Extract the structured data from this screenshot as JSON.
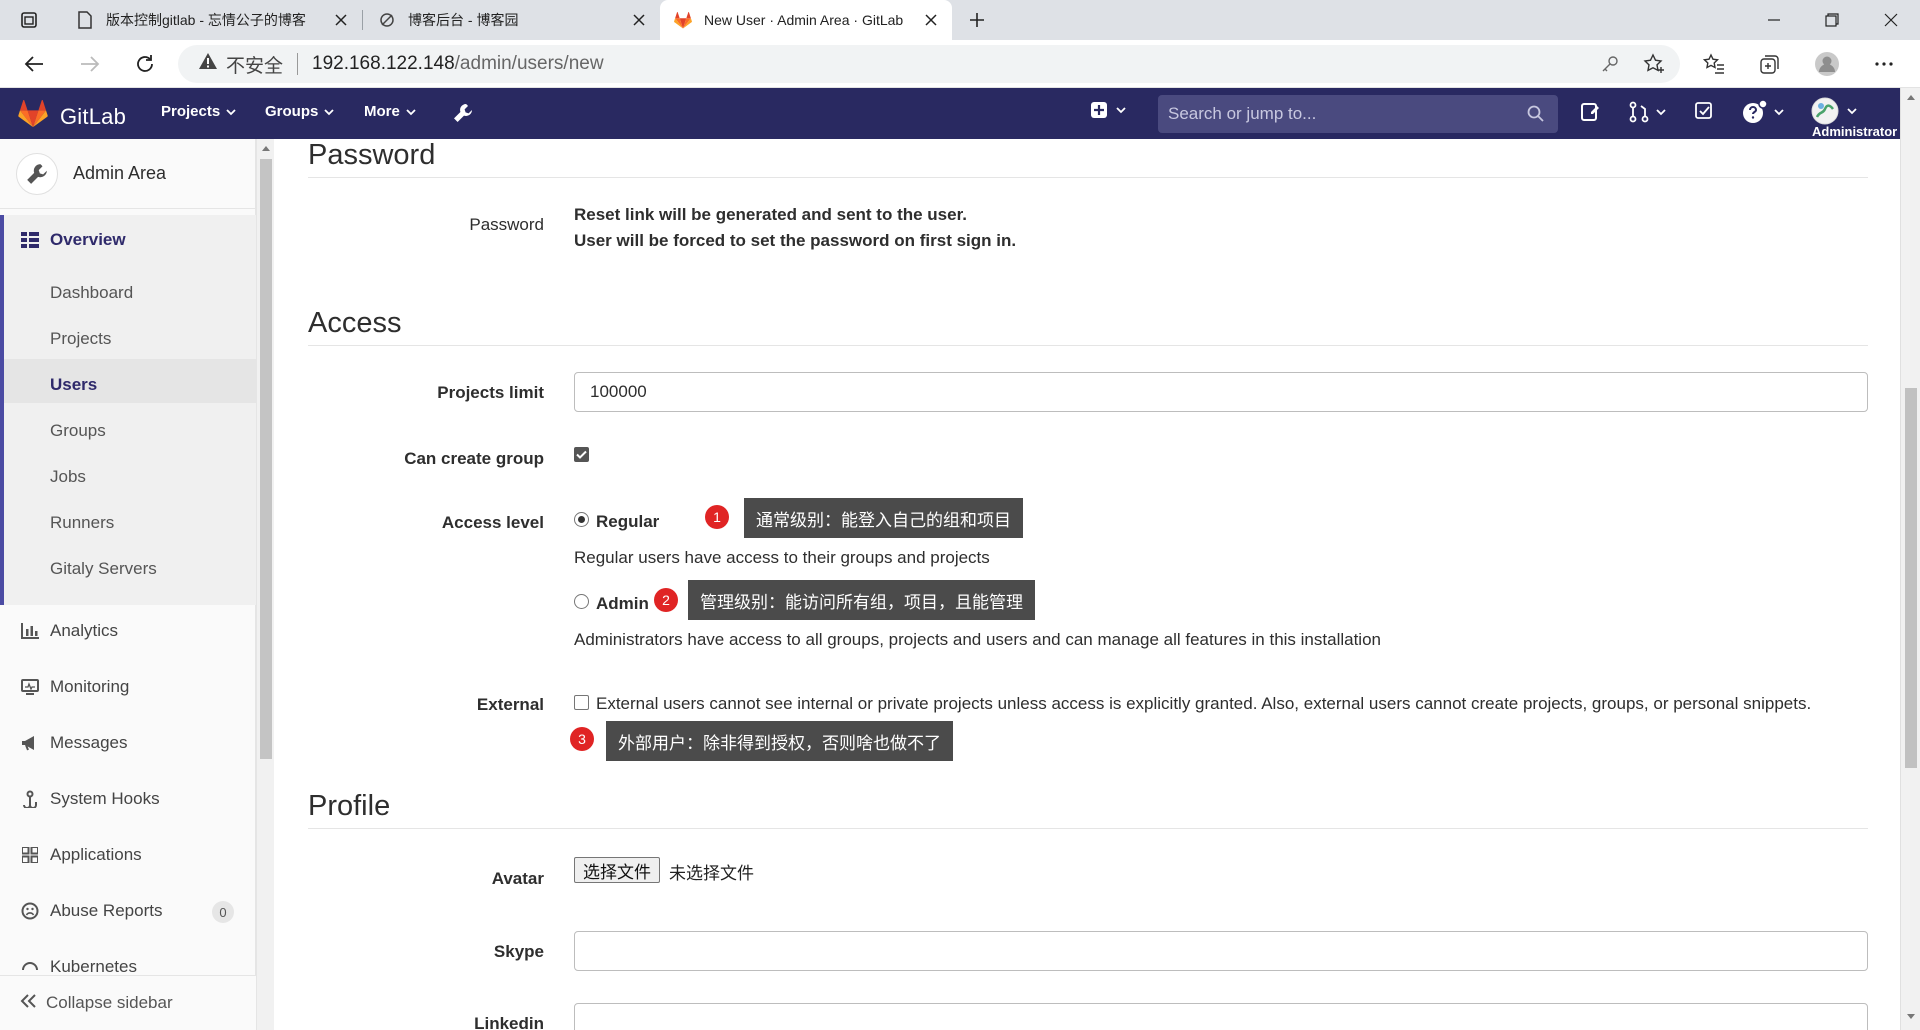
{
  "browser": {
    "tabs": [
      {
        "title": "版本控制gitlab - 忘情公子的博客",
        "icon": "document-icon"
      },
      {
        "title": "博客后台 - 博客园",
        "icon": "cnblogs-icon"
      },
      {
        "title": "New User · Admin Area · GitLab",
        "icon": "gitlab-icon"
      }
    ],
    "address": {
      "insecure_label": "不安全",
      "host": "192.168.122.148",
      "path": "/admin/users/new"
    }
  },
  "navbar": {
    "brand": "GitLab",
    "items": [
      "Projects",
      "Groups",
      "More"
    ],
    "search_placeholder": "Search or jump to...",
    "user_label": "Administrator"
  },
  "sidebar": {
    "header": "Admin Area",
    "overview": "Overview",
    "sub_items": [
      "Dashboard",
      "Projects",
      "Users",
      "Groups",
      "Jobs",
      "Runners",
      "Gitaly Servers"
    ],
    "items": [
      "Analytics",
      "Monitoring",
      "Messages",
      "System Hooks",
      "Applications",
      "Abuse Reports",
      "Kubernetes"
    ],
    "abuse_count": "0",
    "collapse": "Collapse sidebar"
  },
  "form": {
    "password_section": "Password",
    "password_label": "Password",
    "password_line1": "Reset link will be generated and sent to the user.",
    "password_line2": "User will be forced to set the password on first sign in.",
    "access_section": "Access",
    "projects_limit_label": "Projects limit",
    "projects_limit_value": "100000",
    "can_create_group_label": "Can create group",
    "access_level_label": "Access level",
    "regular_label": "Regular",
    "regular_help": "Regular users have access to their groups and projects",
    "admin_label": "Admin",
    "admin_help": "Administrators have access to all groups, projects and users and can manage all features in this installation",
    "external_label": "External",
    "external_help": "External users cannot see internal or private projects unless access is explicitly granted. Also, external users cannot create projects, groups, or personal snippets.",
    "profile_section": "Profile",
    "avatar_label": "Avatar",
    "file_button": "选择文件",
    "file_none": "未选择文件",
    "skype_label": "Skype",
    "linkedin_label": "Linkedin"
  },
  "annotations": [
    {
      "num": "1",
      "text": "通常级别：能登入自己的组和项目"
    },
    {
      "num": "2",
      "text": "管理级别：能访问所有组，项目，且能管理"
    },
    {
      "num": "3",
      "text": "外部用户：除非得到授权，否则啥也做不了"
    }
  ]
}
